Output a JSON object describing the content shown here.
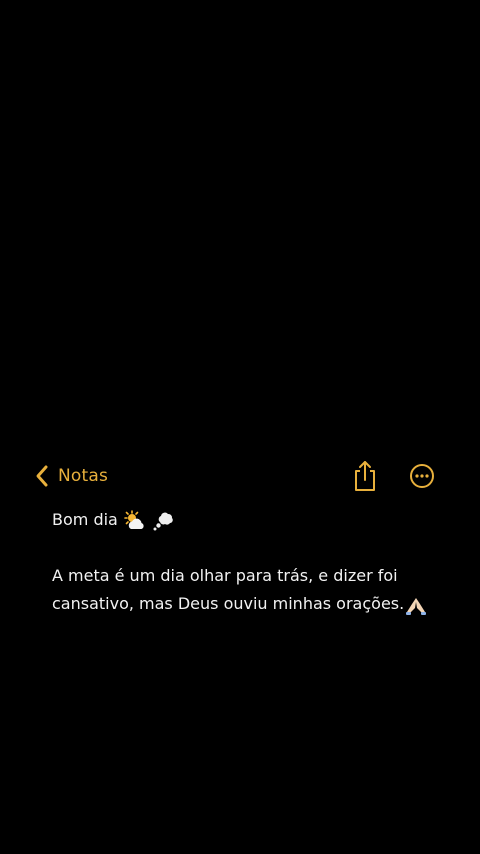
{
  "colors": {
    "background": "#000000",
    "accent": "#e8b03c",
    "text": "#f2f2f2"
  },
  "nav": {
    "back_label": "Notas",
    "back_icon": "chevron-left-icon",
    "share_icon": "share-icon",
    "more_icon": "more-ellipsis-icon"
  },
  "note": {
    "greeting": "Bom dia",
    "greeting_emojis": [
      "sun-behind-cloud-icon",
      "thought-balloon-icon"
    ],
    "body_line_1": "A meta é um dia olhar para trás, e dizer foi",
    "body_line_2": "cansativo, mas Deus ouviu minhas orações.",
    "body_emoji": "folded-hands-icon"
  }
}
